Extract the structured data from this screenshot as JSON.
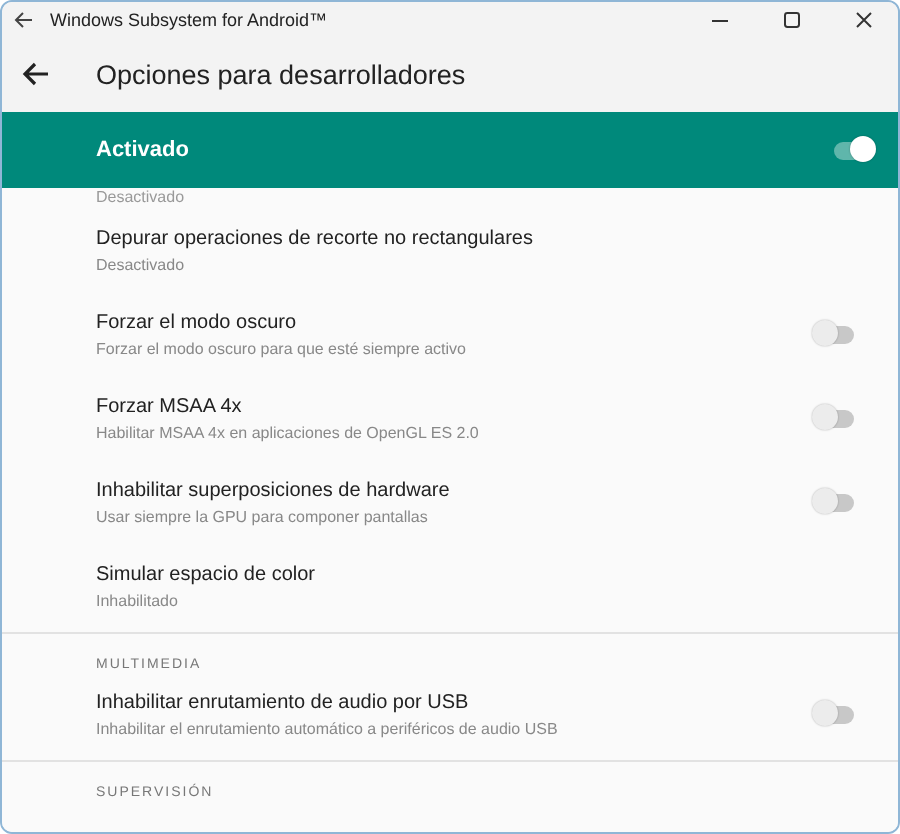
{
  "window": {
    "title": "Windows Subsystem for Android™"
  },
  "app_bar": {
    "title": "Opciones para desarrolladores"
  },
  "master_switch": {
    "label": "Activado",
    "on": true
  },
  "partial_summary": "Desactivado",
  "sections": [
    {
      "items": [
        {
          "kind": "text",
          "title": "Depurar operaciones de recorte no rectangulares",
          "summary": "Desactivado"
        },
        {
          "kind": "toggle",
          "title": "Forzar el modo oscuro",
          "summary": "Forzar el modo oscuro para que esté siempre activo",
          "on": false
        },
        {
          "kind": "toggle",
          "title": "Forzar MSAA 4x",
          "summary": "Habilitar MSAA 4x en aplicaciones de OpenGL ES 2.0",
          "on": false
        },
        {
          "kind": "toggle",
          "title": "Inhabilitar superposiciones de hardware",
          "summary": "Usar siempre la GPU para componer pantallas",
          "on": false
        },
        {
          "kind": "text",
          "title": "Simular espacio de color",
          "summary": "Inhabilitado"
        }
      ]
    },
    {
      "header": "MULTIMEDIA",
      "items": [
        {
          "kind": "toggle",
          "title": "Inhabilitar enrutamiento de audio por USB",
          "summary": "Inhabilitar el enrutamiento automático a periféricos de audio USB",
          "on": false
        }
      ]
    },
    {
      "header": "SUPERVISIÓN"
    }
  ]
}
